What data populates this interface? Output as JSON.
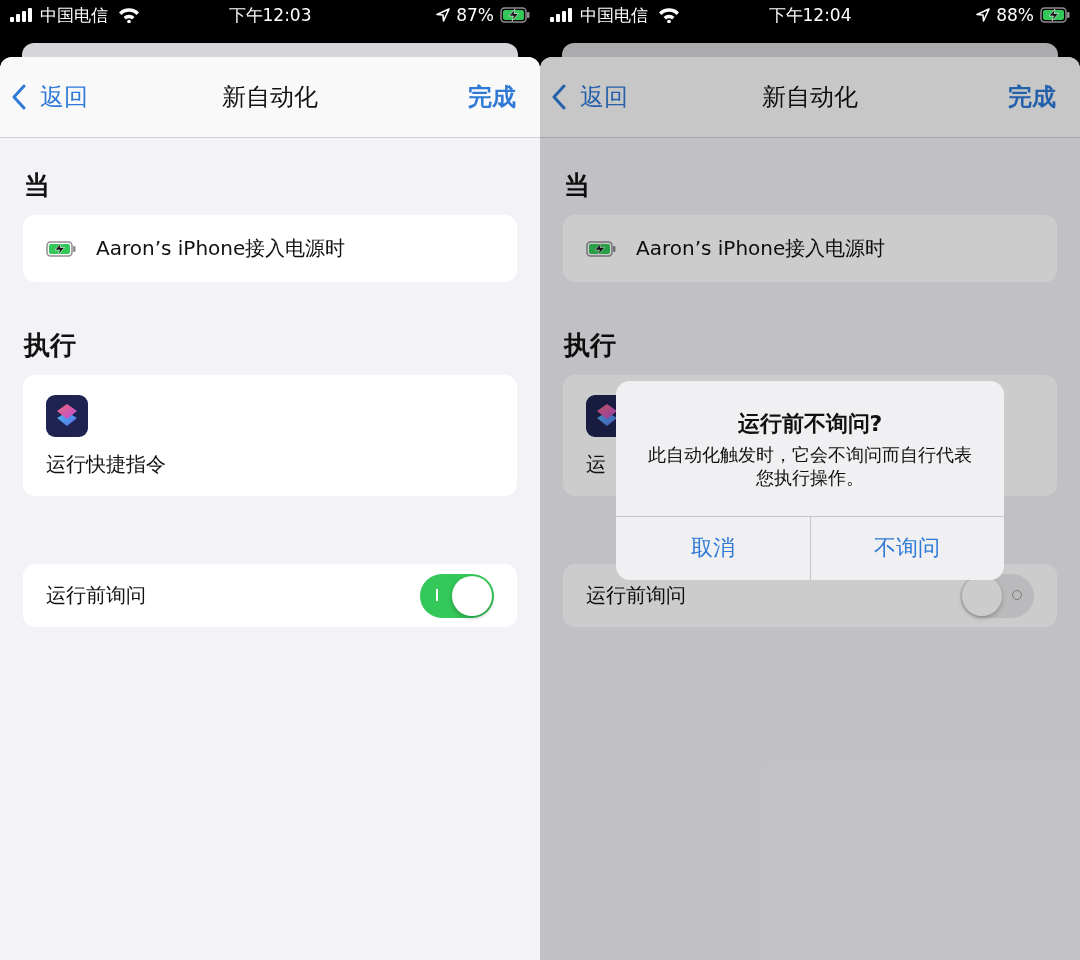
{
  "screens": [
    {
      "status_bar": {
        "carrier": "中国电信",
        "time": "下午12:03",
        "battery": "87%"
      },
      "nav": {
        "back": "返回",
        "title": "新自动化",
        "done": "完成"
      },
      "sections": [
        {
          "header": "当",
          "kind": "trigger",
          "text": "Aaron’s iPhone接入电源时"
        },
        {
          "header": "执行",
          "kind": "action",
          "text": "运行快捷指令"
        }
      ],
      "toggle_row": {
        "label": "运行前询问",
        "on": true
      },
      "dimmed": false
    },
    {
      "status_bar": {
        "carrier": "中国电信",
        "time": "下午12:04",
        "battery": "88%"
      },
      "nav": {
        "back": "返回",
        "title": "新自动化",
        "done": "完成"
      },
      "sections": [
        {
          "header": "当",
          "kind": "trigger",
          "text": "Aaron’s iPhone接入电源时"
        },
        {
          "header": "执行",
          "kind": "action",
          "text": "运"
        }
      ],
      "toggle_row": {
        "label": "运行前询问",
        "on": false
      },
      "dimmed": true,
      "alert": {
        "title": "运行前不询问?",
        "message": "此自动化触发时，它会不询问而自行代表您执行操作。",
        "buttons": [
          "取消",
          "不询问"
        ]
      }
    }
  ]
}
